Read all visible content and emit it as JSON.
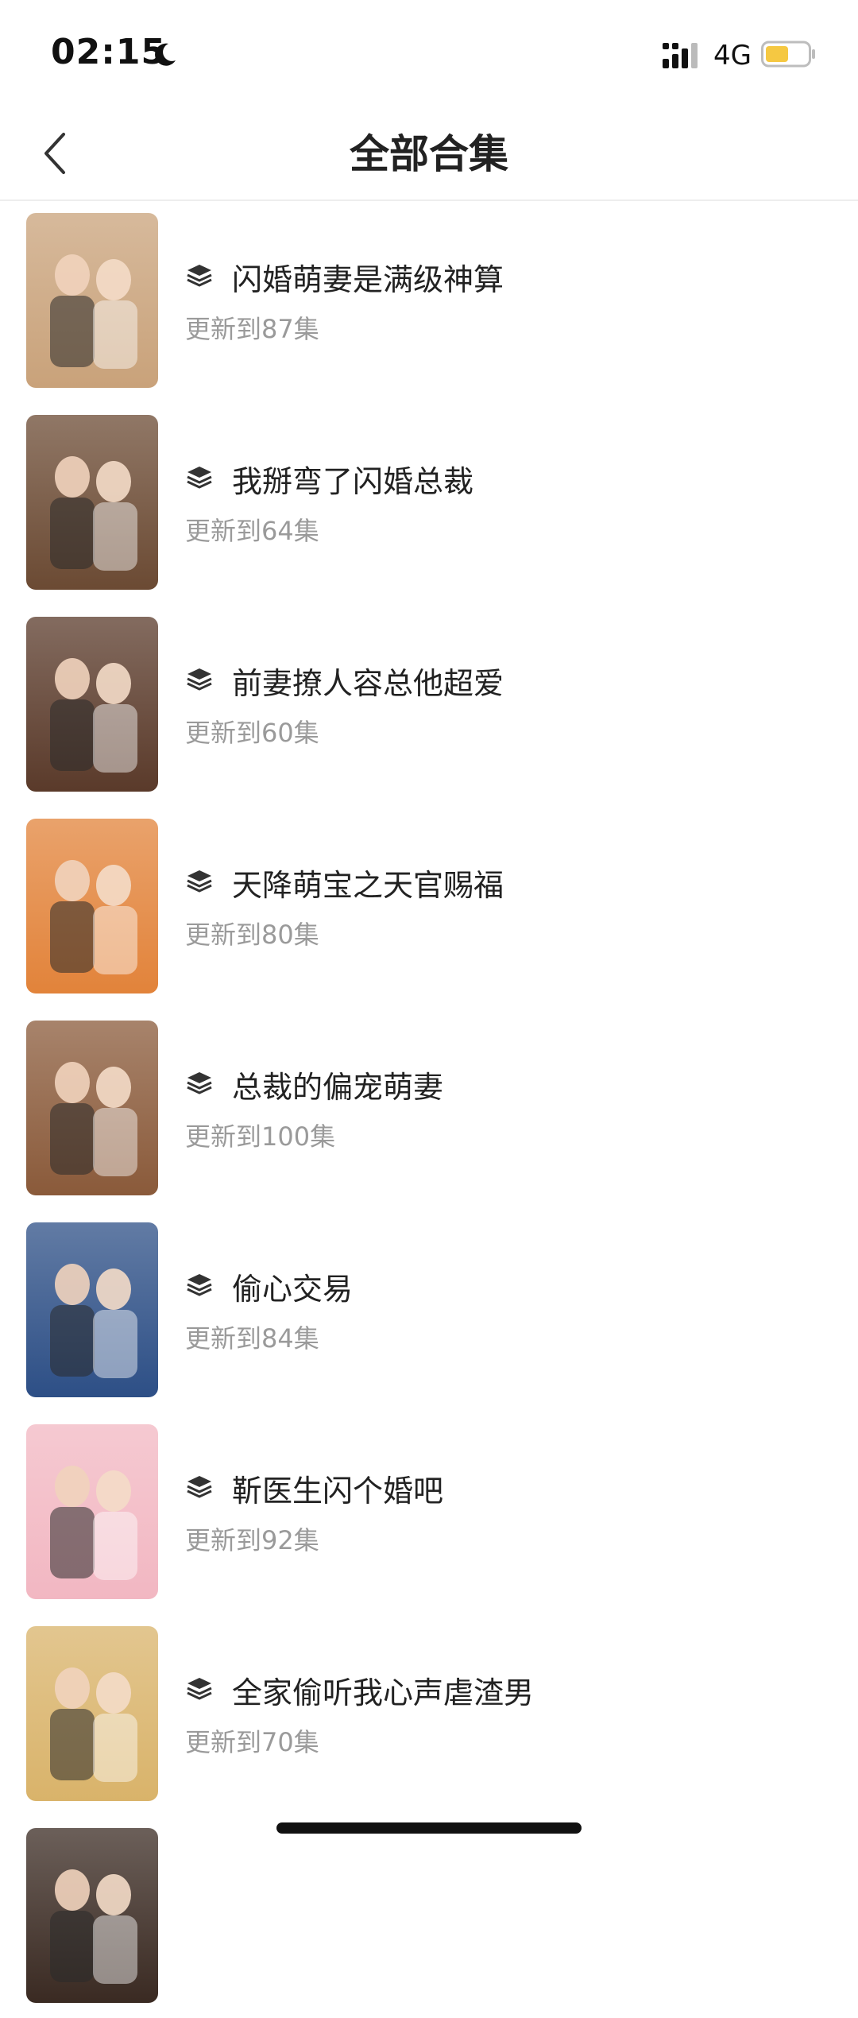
{
  "status_bar": {
    "time": "02:15",
    "network": "4G",
    "battery_color": "#f5c842"
  },
  "nav": {
    "title": "全部合集"
  },
  "collections": [
    {
      "title": "闪婚萌妻是满级神算",
      "subtitle": "更新到87集",
      "cover_color": "#c9a27a"
    },
    {
      "title": "我掰弯了闪婚总裁",
      "subtitle": "更新到64集",
      "cover_color": "#6b4a33"
    },
    {
      "title": "前妻撩人容总他超爱",
      "subtitle": "更新到60集",
      "cover_color": "#5a3a2a"
    },
    {
      "title": "天降萌宝之天官赐福",
      "subtitle": "更新到80集",
      "cover_color": "#e2833a"
    },
    {
      "title": "总裁的偏宠萌妻",
      "subtitle": "更新到100集",
      "cover_color": "#8a5a3a"
    },
    {
      "title": "偷心交易",
      "subtitle": "更新到84集",
      "cover_color": "#2d4f86"
    },
    {
      "title": "靳医生闪个婚吧",
      "subtitle": "更新到92集",
      "cover_color": "#f2b7c2"
    },
    {
      "title": "全家偷听我心声虐渣男",
      "subtitle": "更新到70集",
      "cover_color": "#d9b36a"
    },
    {
      "title": "",
      "subtitle": "",
      "cover_color": "#3a2a22"
    }
  ]
}
